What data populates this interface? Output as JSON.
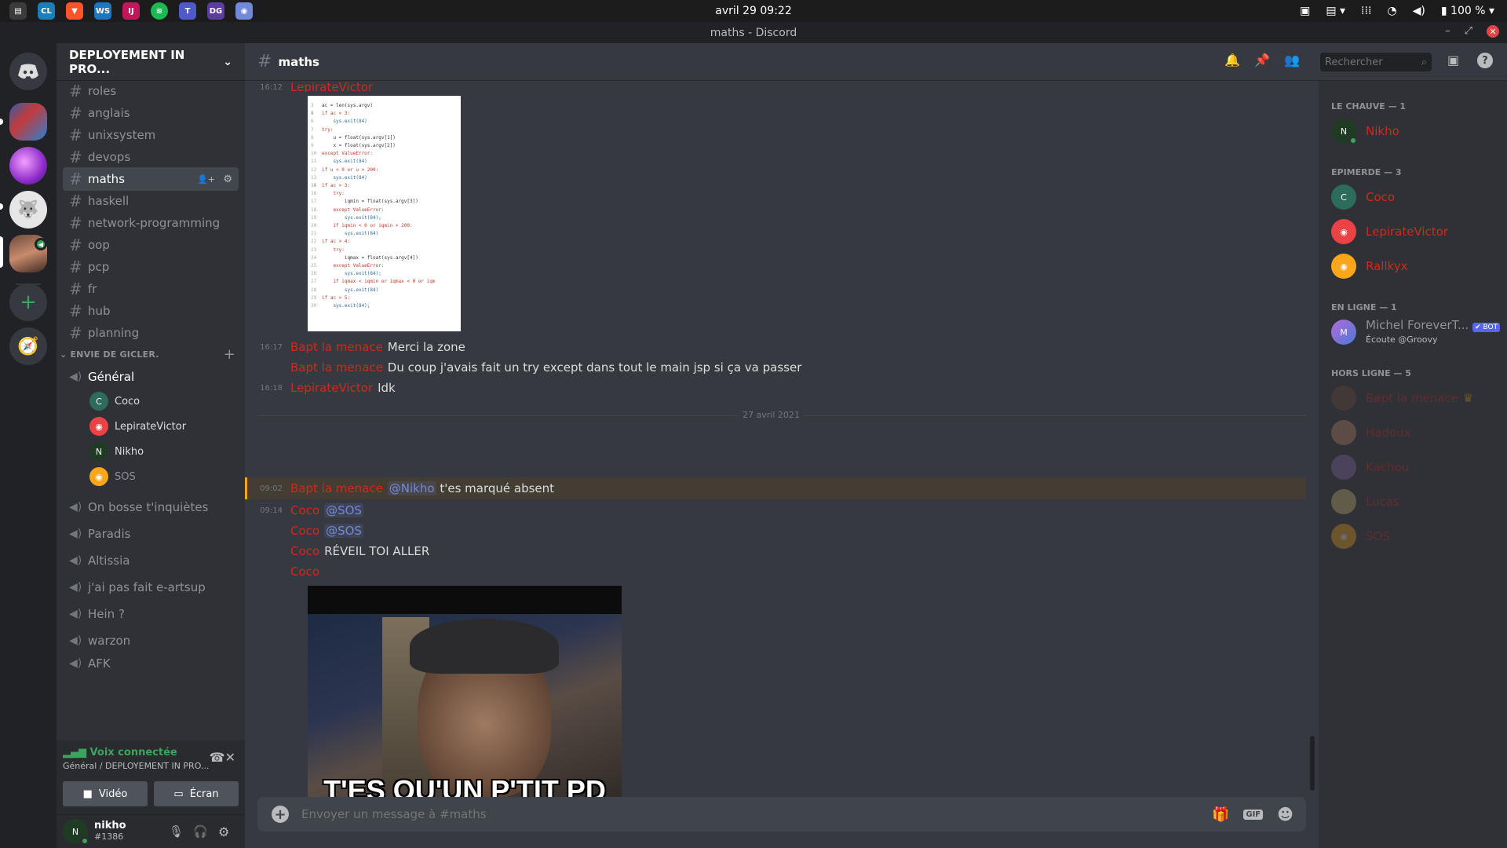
{
  "os": {
    "clock": "avril 29  09:22",
    "battery": "100 %",
    "apps": [
      "CL",
      "B",
      "WS",
      "IJ",
      "SP",
      "T",
      "DG",
      "DC"
    ]
  },
  "window": {
    "title": "maths - Discord"
  },
  "server": {
    "name": "DEPLOYEMENT IN PRO..."
  },
  "channels": {
    "text": [
      "roles",
      "anglais",
      "unixsystem",
      "devops",
      "maths",
      "haskell",
      "network-programming",
      "oop",
      "pcp",
      "fr",
      "hub",
      "planning"
    ],
    "active": "maths",
    "category": "ENVIE DE GICLER.",
    "voice": [
      "Général",
      "On bosse t'inquiètes",
      "Paradis",
      "Altissia",
      "j'ai pas fait e-artsup",
      "Hein ?",
      "warzon",
      "AFK"
    ],
    "voice_users": [
      "Coco",
      "LepirateVictor",
      "Nikho",
      "SOS"
    ]
  },
  "voice_panel": {
    "status": "Voix connectée",
    "location": "Général / DEPLOYEMENT IN PRO...",
    "video": "Vidéo",
    "screen": "Écran"
  },
  "user": {
    "name": "nikho",
    "tag": "#1386"
  },
  "header": {
    "channel": "maths",
    "search_placeholder": "Rechercher"
  },
  "messages": {
    "top_ts": "16:12",
    "top_author": "LepirateVictor",
    "m1": {
      "ts": "16:17",
      "author": "Bapt la menace",
      "text": "Merci la zone"
    },
    "m2": {
      "author": "Bapt la menace",
      "text": "Du coup j'avais fait un try except dans tout le main jsp si ça va passer"
    },
    "m3": {
      "ts": "16:18",
      "author": "LepirateVictor",
      "text": "Idk"
    },
    "divider": "27 avril 2021",
    "m4": {
      "ts": "09:02",
      "author": "Bapt la menace",
      "mention": "@Nikho",
      "text": "t'es marqué absent"
    },
    "m5": {
      "ts": "09:14",
      "author": "Coco",
      "mention": "@SOS"
    },
    "m6": {
      "author": "Coco",
      "mention": "@SOS"
    },
    "m7": {
      "author": "Coco",
      "text": "RÉVEIL TOI ALLER"
    },
    "m8": {
      "author": "Coco"
    },
    "gif_caption": "T'ES QU'UN P'TIT PD"
  },
  "code_lines": [
    "ac = len(sys.argv)",
    "",
    "if ac < 3:",
    "    sys.exit(84)",
    "try:",
    "    u = float(sys.argv[1])",
    "    x = float(sys.argv[2])",
    "except ValueError:",
    "    sys.exit(84)",
    "if u < 0 or u > 200:",
    "    sys.exit(84)",
    "",
    "if ac > 3:",
    "    try:",
    "        iqmin = float(sys.argv[3])",
    "    except ValueError:",
    "        sys.exit(84);",
    "    if iqmin < 0 or iqmin > 200:",
    "        sys.exit(84)",
    "if ac > 4:",
    "    try:",
    "        iqmax = float(sys.argv[4])",
    "    except ValueError:",
    "        sys.exit(84);",
    "    if iqmax < iqmin or iqmax < 0 or iqm",
    "        sys.exit(84)",
    "if ac > 5:",
    "    sys.exit(84);"
  ],
  "members": {
    "groups": [
      {
        "label": "LE CHAUVE — 1",
        "items": [
          {
            "name": "Nikho",
            "color": "#d3281b"
          }
        ]
      },
      {
        "label": "EPIMERDE — 3",
        "items": [
          {
            "name": "Coco",
            "color": "#d3281b"
          },
          {
            "name": "LepirateVictor",
            "color": "#d3281b"
          },
          {
            "name": "Rallkyx",
            "color": "#d3281b"
          }
        ]
      },
      {
        "label": "EN LIGNE — 1",
        "items": [
          {
            "name": "Michel ForeverT...",
            "color": "#8e9297",
            "sub": "Écoute @Groovy",
            "bot": "BOT"
          }
        ]
      },
      {
        "label": "HORS LIGNE — 5",
        "items": [
          {
            "name": "Bapt la menace",
            "color": "#d3281b"
          },
          {
            "name": "Hadoux",
            "color": "#d3281b"
          },
          {
            "name": "Kachou",
            "color": "#d3281b"
          },
          {
            "name": "Lucas",
            "color": "#d3281b"
          },
          {
            "name": "SOS",
            "color": "#d3281b"
          }
        ]
      }
    ]
  },
  "composer": {
    "placeholder": "Envoyer un message à #maths",
    "gif": "GIF"
  }
}
